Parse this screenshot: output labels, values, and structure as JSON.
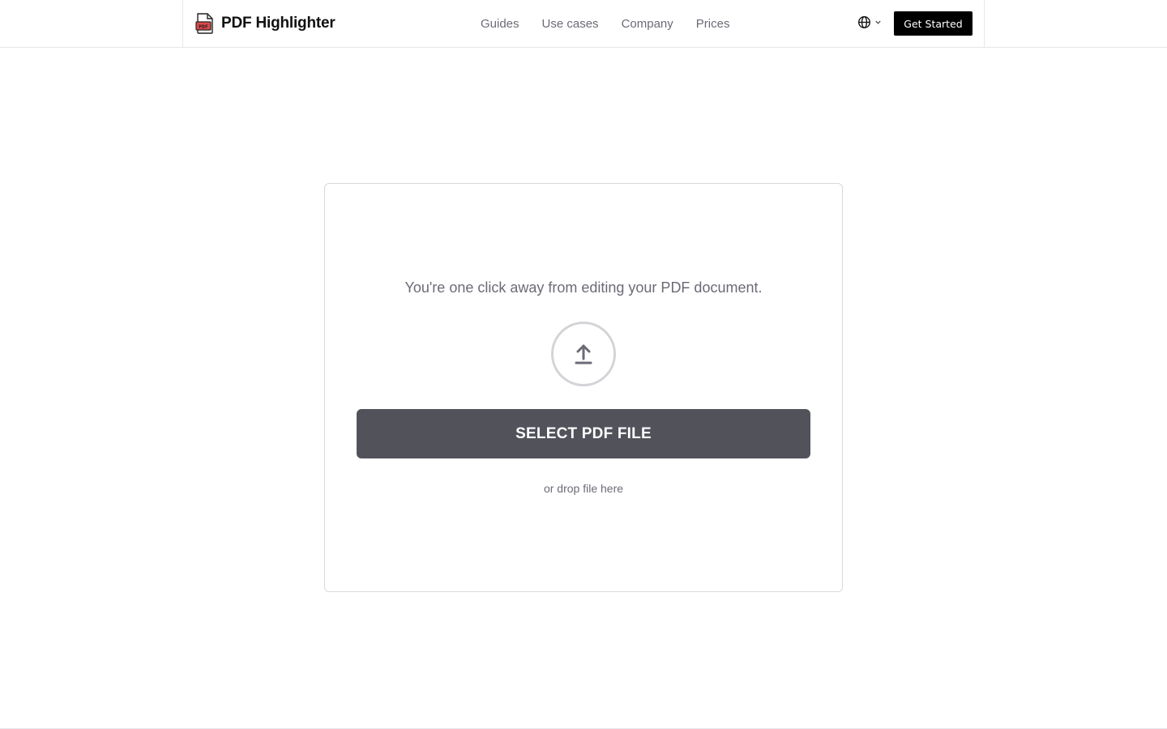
{
  "brand": {
    "name": "PDF Highlighter",
    "icon": "pdf-file-icon",
    "icon_text": "PDF",
    "icon_color": "#e04848"
  },
  "nav": {
    "items": [
      {
        "label": "Guides"
      },
      {
        "label": "Use cases"
      },
      {
        "label": "Company"
      },
      {
        "label": "Prices"
      }
    ]
  },
  "header": {
    "language_icon": "globe-icon",
    "cta_label": "Get Started"
  },
  "upload": {
    "message": "You're one click away from editing your PDF document.",
    "icon": "upload-arrow-icon",
    "button_label": "SELECT PDF FILE",
    "drop_hint": "or drop file here"
  },
  "colors": {
    "cta_bg": "#000000",
    "button_bg": "#52525b",
    "muted_text": "#6b6b76",
    "border": "#d9d9de"
  }
}
